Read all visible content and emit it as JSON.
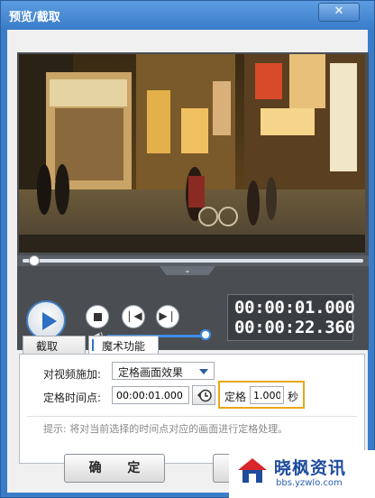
{
  "window": {
    "title": "预览/截取",
    "close_label": "✕"
  },
  "player": {
    "current_time": "00:00:01.000",
    "total_time": "00:00:22.360",
    "scrub_progress": 0.04,
    "volume_level": 1.0
  },
  "tabs": [
    {
      "label": "截取",
      "active": false
    },
    {
      "label": "魔术功能",
      "active": true
    }
  ],
  "magic": {
    "apply_label": "对视频施加:",
    "effect_value": "定格画面效果",
    "time_label": "定格时间点:",
    "time_value": "00:00:01.000",
    "freeze_label": "定格",
    "freeze_value": "1.000",
    "freeze_unit": "秒",
    "hint": "提示: 将对当前选择的时间点对应的画面进行定格处理。"
  },
  "buttons": {
    "ok": "确 定",
    "cancel": ""
  },
  "watermark": {
    "title": "晓枫资讯",
    "url": "bbs.yzwlo.com"
  },
  "colors": {
    "accent": "#3b7cc9",
    "highlight": "#e8a716"
  }
}
